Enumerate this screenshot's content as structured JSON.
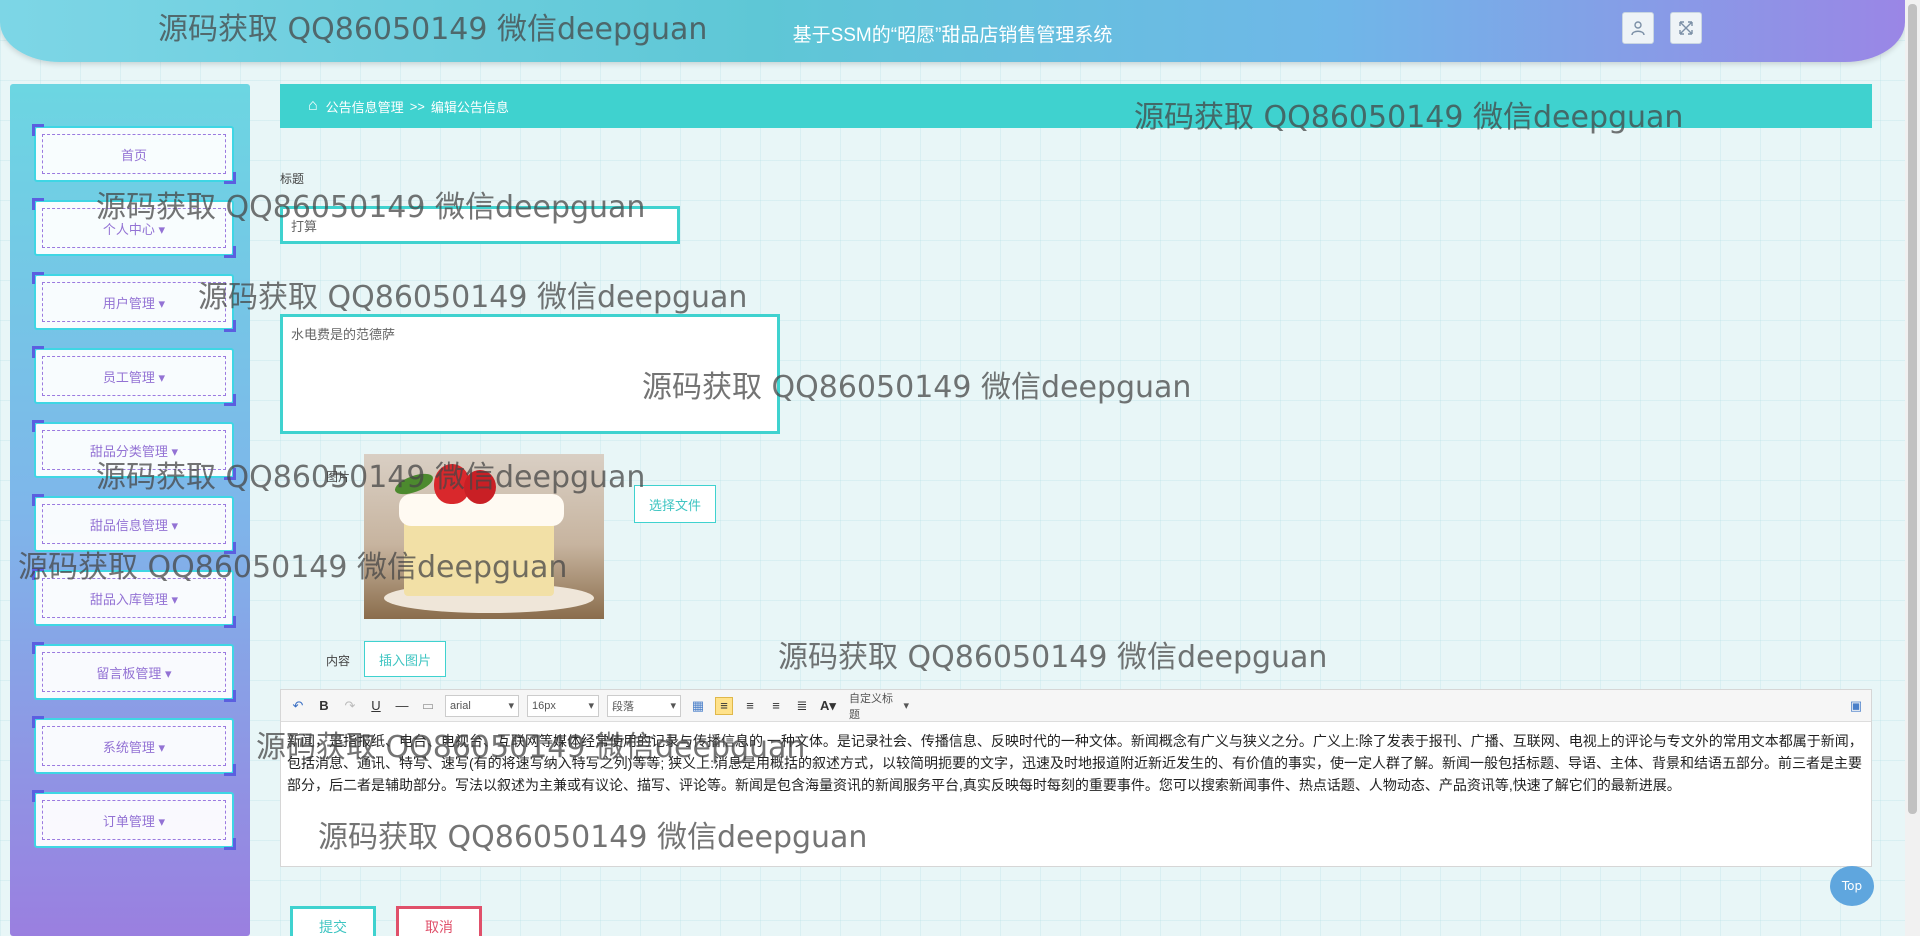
{
  "header": {
    "title": "基于SSM的“昭愿”甜品店销售管理系统",
    "user_icon": "user-icon",
    "fullscreen_icon": "fullscreen-icon"
  },
  "sidebar": {
    "items": [
      {
        "label": "首页"
      },
      {
        "label": "个人中心 ▾"
      },
      {
        "label": "用户管理 ▾"
      },
      {
        "label": "员工管理 ▾"
      },
      {
        "label": "甜品分类管理 ▾"
      },
      {
        "label": "甜品信息管理 ▾"
      },
      {
        "label": "甜品入库管理 ▾"
      },
      {
        "label": "留言板管理 ▾"
      },
      {
        "label": "系统管理 ▾"
      },
      {
        "label": "订单管理 ▾"
      }
    ]
  },
  "breadcrumb": {
    "home_icon": "home-icon",
    "parent": "公告信息管理",
    "separator": ">>",
    "current": "编辑公告信息"
  },
  "form": {
    "title_label": "标题",
    "title_value": "打算",
    "intro_value": "水电费是的范德萨",
    "image_label": "图片",
    "choose_file": "选择文件",
    "content_label": "内容",
    "insert_image": "插入图片"
  },
  "editor": {
    "font": "arial",
    "size": "16px",
    "paragraph": "段落",
    "custom_heading": "自定义标题",
    "content": "新闻，是指报纸、电台、电视台、互联网等媒体经常使用的记录与传播信息的 一种文体。是记录社会、传播信息、反映时代的一种文体。新闻概念有广义与狭义之分。广义上:除了发表于报刊、广播、互联网、电视上的评论与专文外的常用文本都属于新闻，包括消息、通讯、特写、速写(有的将速写纳入特写之列)等等; 狭义上:消息是用概括的叙述方式，以较简明扼要的文字，迅速及时地报道附近新近发生的、有价值的事实，使一定人群了解。新闻一般包括标题、导语、主体、背景和结语五部分。前三者是主要部分，后二者是辅助部分。写法以叙述为主兼或有议论、描写、评论等。新闻是包含海量资讯的新闻服务平台,真实反映每时每刻的重要事件。您可以搜索新闻事件、热点话题、人物动态、产品资讯等,快速了解它们的最新进展。"
  },
  "actions": {
    "submit": "提交",
    "cancel": "取消",
    "top": "Top"
  },
  "watermark": "源码获取 QQ86050149 微信deepguan",
  "colors": {
    "accent": "#3fd2cf",
    "sidebar_text": "#9372d4",
    "cancel": "#e0506a"
  }
}
